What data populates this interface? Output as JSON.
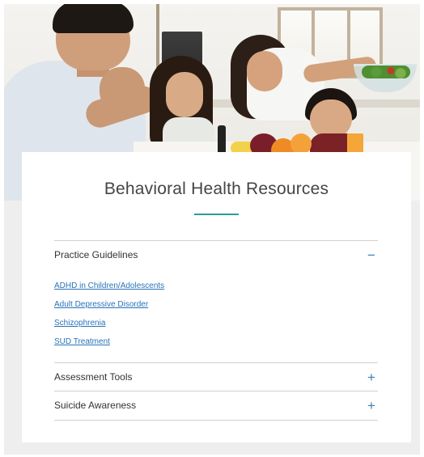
{
  "hero": {
    "alt": "Family gathered at a kitchen table with fruit and salad"
  },
  "page": {
    "title": "Behavioral Health Resources",
    "accent_color": "#2a9d96",
    "link_color": "#2a73b8"
  },
  "accordion": [
    {
      "label": "Practice Guidelines",
      "expanded": true,
      "toggle": "−",
      "links": [
        "ADHD in Children/Adolescents",
        "Adult Depressive Disorder",
        "Schizophrenia",
        "SUD Treatment"
      ]
    },
    {
      "label": "Assessment Tools",
      "expanded": false,
      "toggle": "+"
    },
    {
      "label": "Suicide Awareness",
      "expanded": false,
      "toggle": "+"
    }
  ]
}
